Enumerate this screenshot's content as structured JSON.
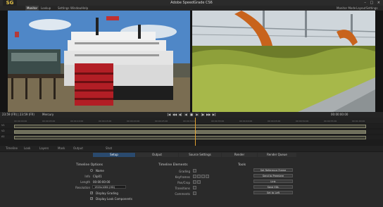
{
  "app": {
    "title": "Adobe SpeedGrade CS6",
    "logo": "SG",
    "window_controls": "– □ ×"
  },
  "menu": {
    "left": [
      "Monitor",
      "Lookup",
      "Settings",
      "Window",
      "Help"
    ],
    "active": "Monitor",
    "right": [
      "Monitor Mode",
      "Layout",
      "Settings"
    ]
  },
  "transport": {
    "timecode_left": "23:59 (FR) | 23:59 (FR)",
    "clip_info": "Mercury",
    "buttons": [
      "|◀",
      "◀◀",
      "◀|",
      "◀",
      "■",
      "▶",
      "|▶",
      "▶▶",
      "▶|"
    ],
    "timecode_right": "00:00:00:00"
  },
  "timeline": {
    "ruler_ticks": [
      "00:00:00:00",
      "00:00:05:00",
      "00:00:10:00",
      "00:00:15:00",
      "00:00:20:00",
      "00:00:25:00",
      "00:00:30:00",
      "00:00:35:00",
      "00:00:40:00",
      "00:00:45:00",
      "00:00:50:00",
      "00:00:55:00",
      "00:01:00:00"
    ],
    "track_names": [
      "V1",
      "V2",
      "A1"
    ]
  },
  "tabs": {
    "bottom": [
      "Timeline",
      "Look",
      "Layers",
      "Mask",
      "Output",
      "Shot"
    ],
    "sub": [
      "Setup",
      "Output",
      "Source Settings",
      "Render",
      "Render Queue"
    ],
    "active_sub": "Setup"
  },
  "panels": {
    "timeline_options": {
      "title": "Timeline Options",
      "rows": [
        {
          "label": "Name",
          "value": ""
        },
        {
          "label": "Info",
          "value": "Clip01"
        },
        {
          "label": "Length",
          "value": "00:00:00:00"
        },
        {
          "label": "Resolution",
          "value": "1920x1080 (HD)"
        }
      ],
      "checks": [
        "Display Grading",
        "Display Look Components"
      ]
    },
    "timeline_elements": {
      "title": "Timeline Elements",
      "rows": [
        "Grading",
        "Keyframes",
        "Pan/Crop",
        "Transitions",
        "Comments"
      ]
    },
    "tools": {
      "title": "Tools",
      "buttons": [
        "Set Reference Frame",
        "Send to Premiere",
        "Link",
        "Send EDL",
        "Set to Left"
      ]
    }
  },
  "colors": {
    "accent": "#2a4a6e",
    "playhead": "#e0a030",
    "logo": "#e6c34a"
  }
}
